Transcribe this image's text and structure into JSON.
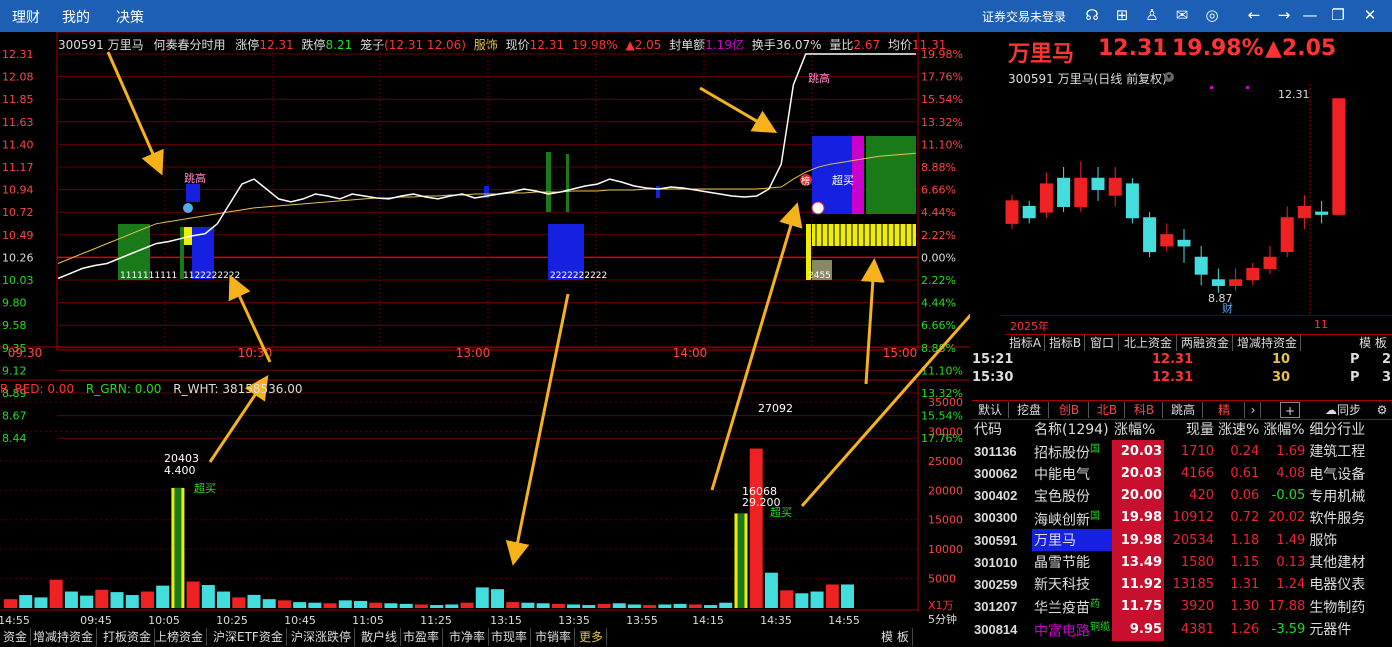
{
  "menu": [
    "理财",
    "我的",
    "决策"
  ],
  "top_right": {
    "login": "证券交易未登录"
  },
  "icons": [
    "support-icon",
    "sync-icon",
    "shirt-icon",
    "mail-icon",
    "settings-icon",
    "back-icon",
    "forward-icon",
    "minimize-icon",
    "restore-icon",
    "close-icon"
  ],
  "header": {
    "code_name": "300591 万里马",
    "chart_title": "何奏春分时用",
    "limit_up_label": "涨停",
    "limit_up": "12.31",
    "limit_down_label": "跌停",
    "limit_down": "8.21",
    "cage_label": "笼子",
    "cage": "(12.31 12.06)",
    "sector": "服饰",
    "price_label": "现价",
    "price": "12.31",
    "pct": "19.98%",
    "chg": "▲2.05",
    "seal_label": "封单额",
    "seal": "1.19亿",
    "turnover_label": "换手",
    "turnover": "36.07%",
    "vol_ratio_label": "量比",
    "vol_ratio": "2.67",
    "avg_label": "均价",
    "avg": "11.31"
  },
  "chart_data": [
    {
      "type": "line",
      "name": "intraday",
      "price_ticks": [
        "12.31",
        "12.08",
        "11.85",
        "11.63",
        "11.40",
        "11.17",
        "10.94",
        "10.72",
        "10.49",
        "10.26",
        "10.03",
        "9.80",
        "9.58",
        "9.35",
        "9.12",
        "8.89",
        "8.67",
        "8.44"
      ],
      "pct_ticks": [
        "19.98%",
        "17.76%",
        "15.54%",
        "13.32%",
        "11.10%",
        "8.88%",
        "6.66%",
        "4.44%",
        "2.22%",
        "0.00%",
        "2.22%",
        "4.44%",
        "6.66%",
        "8.88%",
        "11.10%",
        "13.32%",
        "15.54%",
        "17.76%"
      ],
      "time_ticks": [
        "09:30",
        "10:30",
        "13:00",
        "14:00",
        "15:00"
      ],
      "ylim": [
        8.44,
        12.31
      ],
      "price": [
        10.05,
        10.1,
        10.15,
        10.18,
        10.2,
        10.25,
        10.3,
        10.35,
        10.4,
        10.42,
        10.45,
        10.48,
        10.5,
        10.6,
        10.8,
        11.0,
        11.05,
        10.95,
        10.85,
        10.82,
        10.85,
        10.9,
        10.88,
        10.85,
        10.9,
        10.88,
        10.86,
        10.85,
        10.88,
        10.9,
        10.87,
        10.85,
        10.88,
        10.9,
        10.86,
        10.88,
        10.9,
        10.92,
        10.95,
        10.93,
        10.9,
        10.92,
        10.95,
        10.98,
        11.0,
        11.05,
        11.02,
        10.98,
        10.96,
        10.95,
        10.97,
        10.96,
        10.94,
        10.92,
        10.9,
        10.88,
        10.87,
        10.88,
        10.95,
        11.2,
        12.0,
        12.31,
        12.31,
        12.31,
        12.31,
        12.31,
        12.31,
        12.31,
        12.31,
        12.31,
        12.31
      ],
      "avg": [
        10.2,
        10.25,
        10.3,
        10.35,
        10.4,
        10.45,
        10.5,
        10.55,
        10.6,
        10.62,
        10.64,
        10.66,
        10.68,
        10.7,
        10.72,
        10.74,
        10.76,
        10.77,
        10.78,
        10.79,
        10.8,
        10.81,
        10.82,
        10.83,
        10.84,
        10.85,
        10.86,
        10.86,
        10.87,
        10.87,
        10.88,
        10.88,
        10.89,
        10.89,
        10.9,
        10.9,
        10.9,
        10.91,
        10.91,
        10.92,
        10.92,
        10.92,
        10.93,
        10.93,
        10.93,
        10.94,
        10.94,
        10.94,
        10.95,
        10.95,
        10.95,
        10.95,
        10.95,
        10.95,
        10.95,
        10.95,
        10.95,
        10.95,
        10.96,
        10.97,
        11.05,
        11.12,
        11.17,
        11.2,
        11.22,
        11.24,
        11.26,
        11.28,
        11.29,
        11.3,
        11.31
      ],
      "annotations": [
        "跳高",
        "跳高",
        "超买",
        "榜"
      ]
    },
    {
      "type": "bar",
      "name": "volume",
      "legend": {
        "red": "R_RED: 0.00",
        "green": "R_GRN: 0.00",
        "white": "R_WHT: 38158536.00"
      },
      "y_ticks": [
        "35000",
        "30000",
        "25000",
        "20000",
        "15000",
        "10000",
        "5000"
      ],
      "unit": "X1万",
      "time_ticks": [
        "14:55",
        "09:45",
        "10:05",
        "10:25",
        "10:45",
        "11:05",
        "11:25",
        "13:15",
        "13:35",
        "13:55",
        "14:15",
        "14:35",
        "14:55"
      ],
      "period": "5分钟",
      "values": [
        1500,
        2200,
        1800,
        4800,
        2800,
        2100,
        3100,
        2700,
        2200,
        2800,
        3800,
        20403,
        4500,
        3900,
        2800,
        1800,
        2231,
        1500,
        1300,
        1000,
        900,
        800,
        1300,
        1200,
        900,
        800,
        700,
        600,
        500,
        600,
        900,
        3500,
        3200,
        1000,
        900,
        800,
        700,
        600,
        500,
        700,
        800,
        600,
        500,
        600,
        700,
        600,
        500,
        900,
        16068,
        27092,
        6000,
        3000,
        2500,
        2800,
        4000,
        4000
      ],
      "labels": [
        {
          "v": "20403",
          "sub": "4.400",
          "tag": "超买"
        },
        {
          "v": "16068",
          "sub": "29.200",
          "tag": "超买"
        },
        {
          "v": "27092"
        }
      ]
    }
  ],
  "right": {
    "name": "万里马",
    "price": "12.31",
    "pct": "19.98%",
    "chg": "▲2.05",
    "kline_title": "300591 万里马(日线 前复权)",
    "hi_label": "12.31",
    "lo_label": "8.87",
    "lo_tag": "财",
    "year": "2025年",
    "month": "11",
    "tabs": [
      "指标A",
      "指标B",
      "窗口",
      "北上资金",
      "两融资金",
      "增减持资金",
      "模 板"
    ],
    "trades": [
      {
        "time": "15:21",
        "price": "12.31",
        "vol": "10",
        "dir": "P",
        "n": "2"
      },
      {
        "time": "15:30",
        "price": "12.31",
        "vol": "30",
        "dir": "P",
        "n": "3"
      }
    ],
    "list_tabs": [
      "默认",
      "挖盘",
      "创B",
      "北B",
      "科B",
      "跳高",
      "精"
    ],
    "sync": "同步",
    "cols": [
      "代码",
      "名称(1294)",
      "涨幅%",
      "现量",
      "涨速%",
      "涨幅%",
      "细分行业"
    ],
    "rows": [
      {
        "code": "301136",
        "name": "招标股份",
        "tag": "国",
        "pct": "20.03",
        "vol": "1710",
        "spd": "0.24",
        "chg": "1.69",
        "ind": "建筑工程"
      },
      {
        "code": "300062",
        "name": "中能电气",
        "tag": "",
        "pct": "20.03",
        "vol": "4166",
        "spd": "0.61",
        "chg": "4.08",
        "ind": "电气设备"
      },
      {
        "code": "300402",
        "name": "宝色股份",
        "tag": "",
        "pct": "20.00",
        "vol": "420",
        "spd": "0.06",
        "chg": "-0.05",
        "ind": "专用机械"
      },
      {
        "code": "300300",
        "name": "海峡创新",
        "tag": "国",
        "pct": "19.98",
        "vol": "10912",
        "spd": "0.72",
        "chg": "20.02",
        "ind": "软件服务"
      },
      {
        "code": "300591",
        "name": "万里马",
        "tag": "",
        "pct": "19.98",
        "vol": "20534",
        "spd": "1.18",
        "chg": "1.49",
        "ind": "服饰"
      },
      {
        "code": "301010",
        "name": "晶雪节能",
        "tag": "",
        "pct": "13.49",
        "vol": "1580",
        "spd": "1.15",
        "chg": "0.13",
        "ind": "其他建材"
      },
      {
        "code": "300259",
        "name": "新天科技",
        "tag": "",
        "pct": "11.92",
        "vol": "13185",
        "spd": "1.31",
        "chg": "1.24",
        "ind": "电器仪表"
      },
      {
        "code": "301207",
        "name": "华兰疫苗",
        "tag": "药",
        "pct": "11.75",
        "vol": "3920",
        "spd": "1.30",
        "chg": "17.88",
        "ind": "生物制药"
      },
      {
        "code": "300814",
        "name": "中富电路",
        "tag": "铜缆",
        "pct": "9.95",
        "vol": "4381",
        "spd": "1.26",
        "chg": "-3.59",
        "ind": "元器件"
      }
    ]
  },
  "bottom_tabs": [
    "资金",
    "增减持资金",
    "打板资金",
    "上榜资金",
    "沪深ETF资金",
    "沪深涨跌停",
    "散户线",
    "市盈率",
    "市净率",
    "市现率",
    "市销率",
    "更多",
    "模 板"
  ]
}
